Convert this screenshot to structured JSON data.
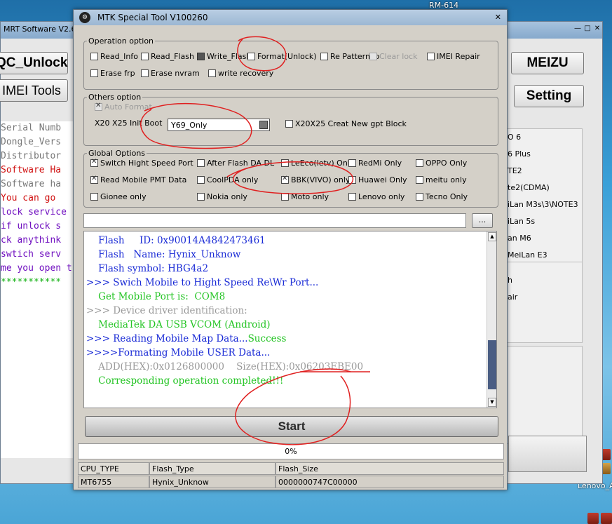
{
  "desktop": {
    "top_label": "RM-614",
    "bottom_label": "Lenovo_A"
  },
  "mrt": {
    "title": "MRT Software V2.6",
    "buttons": {
      "qc_unlock": "QC_Unlock",
      "imei_tools": "IMEI Tools",
      "meizu": "MEIZU",
      "setting": "Setting"
    },
    "log_lines": [
      {
        "text": "  Serial Numb",
        "color": "#777777"
      },
      {
        "text": "  Dongle_Vers",
        "color": "#777777"
      },
      {
        "text": "  Distributor",
        "color": "#777777"
      },
      {
        "text": "  Software Ha",
        "color": "#d01010"
      },
      {
        "text": "  Software ha",
        "color": "#777777"
      },
      {
        "text": "  You can go ",
        "color": "#d01010"
      },
      {
        "text": "lock service ",
        "color": "#7010c0"
      },
      {
        "text": "  if unlock s",
        "color": "#7010c0"
      },
      {
        "text": "ck anythink ",
        "color": "#7010c0"
      },
      {
        "text": "  swtich serv",
        "color": "#7010c0"
      },
      {
        "text": "me you open t",
        "color": "#7010c0"
      },
      {
        "text": "  ***********",
        "color": "#10b010"
      }
    ],
    "right_list": [
      "O 6",
      "6 Plus",
      "TE2",
      "te2(CDMA)",
      "iLan M3s\\3\\NOTE3",
      "iLan 5s",
      "an M6",
      "MeiLan E3"
    ],
    "right_list2": [
      "h",
      "air"
    ]
  },
  "mtk": {
    "title": "MTK Special Tool V100260",
    "operation": {
      "legend": "Operation option",
      "options": [
        {
          "label": "Read_Info",
          "checked": false,
          "disabled": false
        },
        {
          "label": "Read_Flash",
          "checked": false,
          "disabled": false
        },
        {
          "label": "Write_Flash",
          "checked": false,
          "disabled": false
        },
        {
          "label": "Format(Unlock)",
          "checked": false,
          "disabled": false
        },
        {
          "label": "Re Pattern lo",
          "checked": false,
          "disabled": false
        },
        {
          "label": "Clear lock",
          "checked": false,
          "disabled": true
        },
        {
          "label": "IMEI Repair",
          "checked": false,
          "disabled": false
        },
        {
          "label": "Erase frp",
          "checked": false,
          "disabled": false
        },
        {
          "label": "Erase nvram",
          "checked": false,
          "disabled": false
        },
        {
          "label": "write recovery",
          "checked": false,
          "disabled": false
        }
      ]
    },
    "others": {
      "legend": "Others option",
      "auto_format": "Auto Format",
      "init_boot_label": "X20 X25 Init Boot",
      "init_boot_value": "Y69_Only",
      "gpt_label": "X20X25 Creat New gpt Block"
    },
    "global": {
      "legend": "Global Options",
      "options": [
        {
          "label": "Switch Hight Speed Port",
          "checked": true
        },
        {
          "label": "After Flash DA DL",
          "checked": false
        },
        {
          "label": "LeEco(letv) Only",
          "checked": false
        },
        {
          "label": "RedMi Only",
          "checked": false
        },
        {
          "label": "OPPO Only",
          "checked": false
        },
        {
          "label": "Read Mobile PMT Data",
          "checked": true
        },
        {
          "label": "CoolPDA only",
          "checked": false
        },
        {
          "label": "BBK(VIVO) only",
          "checked": true
        },
        {
          "label": "Huawei Only",
          "checked": false
        },
        {
          "label": "meitu only",
          "checked": false
        },
        {
          "label": "Gionee only",
          "checked": false
        },
        {
          "label": "Nokia only",
          "checked": false
        },
        {
          "label": "Moto only",
          "checked": false
        },
        {
          "label": "Lenovo only",
          "checked": false
        },
        {
          "label": "Tecno Only",
          "checked": false
        }
      ]
    },
    "browse_label": "...",
    "log": [
      {
        "text": "    Flash     ID: 0x90014A4842473461",
        "class": "c-blue"
      },
      {
        "text": "    Flash   Name: Hynix_Unknow",
        "class": "c-blue"
      },
      {
        "text": "    Flash symbol: HBG4a2",
        "class": "c-blue"
      },
      {
        "text": ">>> Swich Mobile to Hight Speed Re\\Wr Port...",
        "class": "c-blue"
      },
      {
        "text": "    Get Mobile Port is:  COM8",
        "class": "c-green"
      },
      {
        "text": ">>> Device driver identification:",
        "class": "c-gray"
      },
      {
        "text": "    MediaTek DA USB VCOM (Android)",
        "class": "c-green"
      },
      {
        "text": ">>> Reading Mobile Map Data...",
        "class": "c-blue",
        "suffix": "Success"
      },
      {
        "text": ">>>>Formating Mobile USER Data...",
        "class": "c-blue"
      },
      {
        "text": "    ADD(HEX):0x0126800000    Size(HEX):0x06203EBE00",
        "class": "c-gray"
      },
      {
        "text": "    Corresponding operation completed!!!",
        "class": "c-green"
      }
    ],
    "start_label": "Start",
    "progress_value": 0,
    "progress_text": "0%",
    "info": {
      "headers": [
        "CPU_TYPE",
        "Flash_Type",
        "Flash_Size"
      ],
      "values": [
        "MT6755",
        "Hynix_Unknow",
        "0000000747C00000"
      ]
    }
  }
}
